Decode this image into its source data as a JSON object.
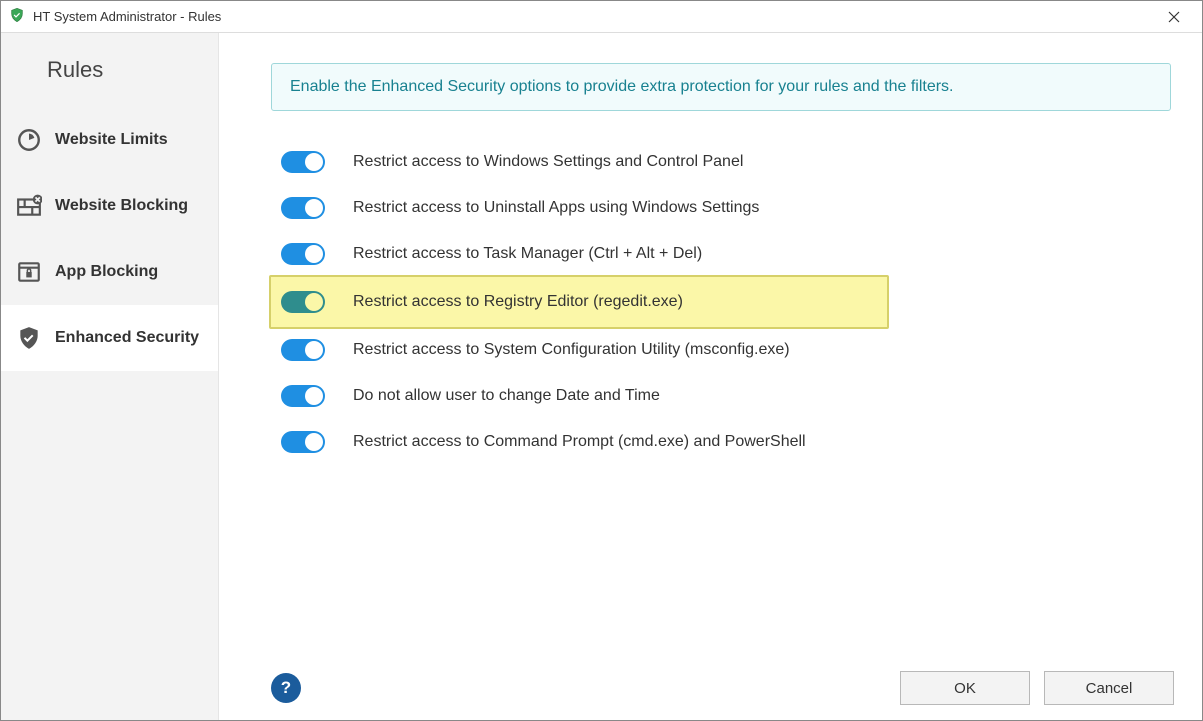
{
  "window": {
    "title": "HT System Administrator - Rules"
  },
  "sidebar": {
    "header": "Rules",
    "items": [
      {
        "label": "Website Limits"
      },
      {
        "label": "Website Blocking"
      },
      {
        "label": "App Blocking"
      },
      {
        "label": "Enhanced Security"
      }
    ]
  },
  "banner": "Enable the Enhanced Security options to provide extra protection for your rules and the filters.",
  "options": [
    {
      "label": "Restrict access to Windows Settings and Control Panel"
    },
    {
      "label": "Restrict access to Uninstall Apps using Windows Settings"
    },
    {
      "label": "Restrict access to Task Manager (Ctrl + Alt + Del)"
    },
    {
      "label": "Restrict access to Registry Editor (regedit.exe)"
    },
    {
      "label": "Restrict access to System Configuration Utility (msconfig.exe)"
    },
    {
      "label": "Do not allow user to change Date and Time"
    },
    {
      "label": "Restrict access to Command Prompt (cmd.exe) and PowerShell"
    }
  ],
  "buttons": {
    "ok": "OK",
    "cancel": "Cancel"
  }
}
